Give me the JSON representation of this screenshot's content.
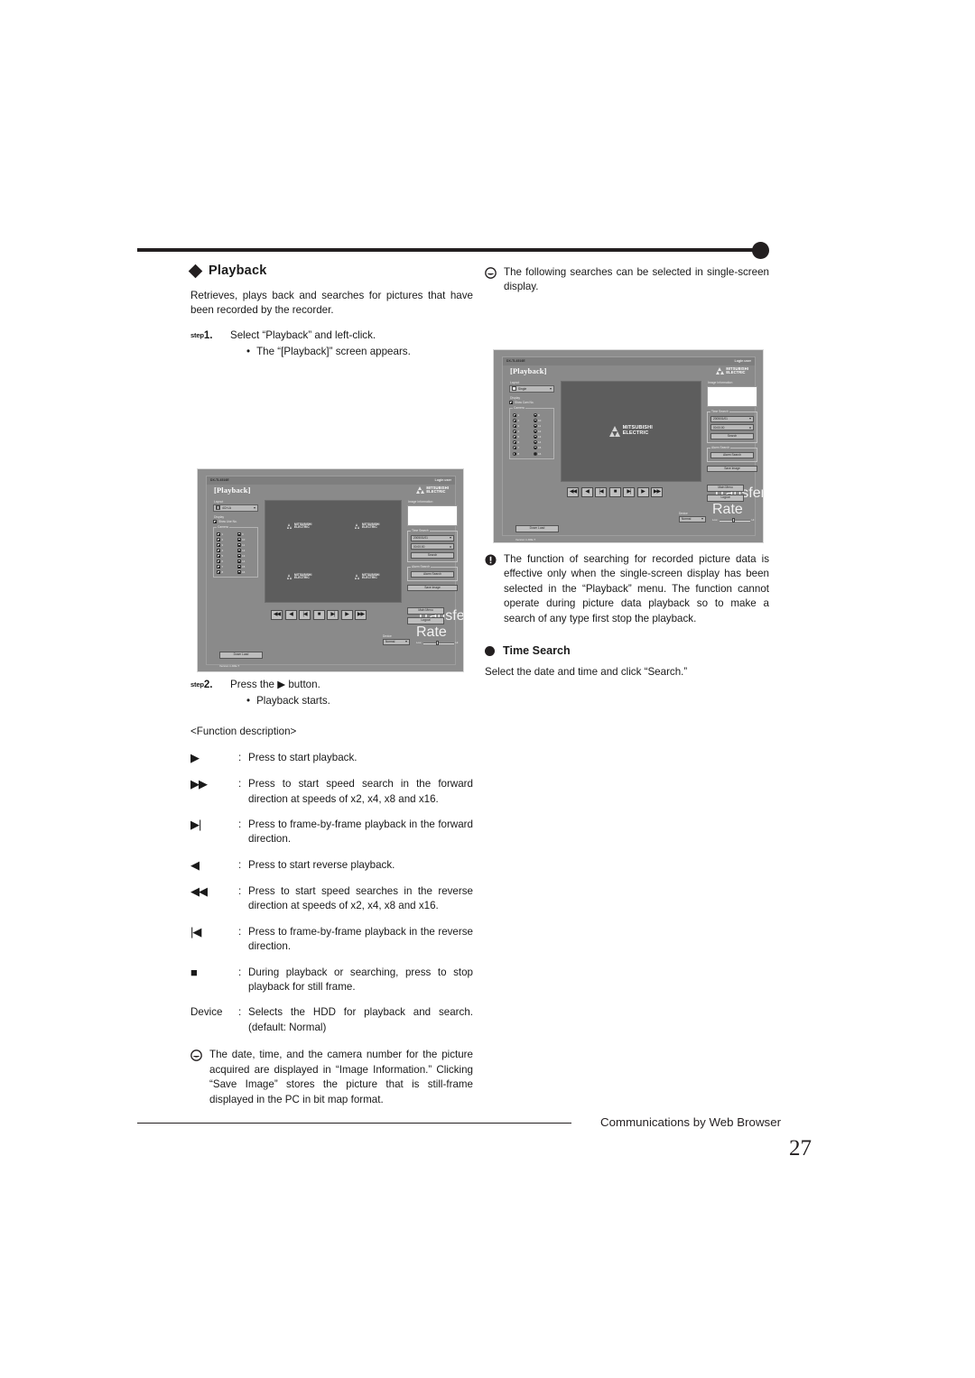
{
  "page": {
    "number": "27",
    "footer_text": "Communications by Web Browser"
  },
  "left_column": {
    "heading": "Playback",
    "intro": "Retrieves, plays back and searches for pictures that have been recorded by the recorder.",
    "step1": {
      "label_sup": "step",
      "label_num": "1.",
      "text": "Select “Playback” and left-click.",
      "bullet_dot": "•",
      "bullet": "The “[Playback]” screen appears."
    },
    "step2": {
      "label_sup": "step",
      "label_num": "2.",
      "text": "Press the ▶ button.",
      "bullet_dot": "•",
      "bullet": "Playback starts."
    },
    "function_description_heading": "<Function description>",
    "functions": [
      {
        "key": "▶",
        "colon": ":",
        "text": "Press to start playback."
      },
      {
        "key": "▶▶",
        "colon": ":",
        "text": "Press to start speed search in the forward direction at speeds of x2, x4, x8 and x16."
      },
      {
        "key": "▶|",
        "colon": ":",
        "text": "Press to frame-by-frame playback in the forward direction."
      },
      {
        "key": "◀",
        "colon": ":",
        "text": "Press to start reverse playback."
      },
      {
        "key": "◀◀",
        "colon": ":",
        "text": "Press to start speed searches in the reverse direction at speeds of x2, x4, x8 and x16."
      },
      {
        "key": "|◀",
        "colon": ":",
        "text": "Press to frame-by-frame playback in the reverse direction."
      },
      {
        "key": "■",
        "colon": ":",
        "text": "During playback or searching, press to stop playback for still frame."
      },
      {
        "key": "Device",
        "colon": ":",
        "text": "Selects the HDD for playback and search. (default: Normal)"
      }
    ],
    "note": "The date, time, and the camera number for the picture acquired are displayed in “Image Information.” Clicking “Save Image” stores the picture that is still-frame displayed in the PC in bit map format."
  },
  "right_column": {
    "note_top": "The following searches can be selected in single-screen display.",
    "warning": "The function of searching for recorded picture data is effective only when the single-screen display has been selected in the “Playback” menu. The function cannot operate during picture data playback so to make a search of any type first stop the playback.",
    "time_search_heading": "Time Search",
    "time_search_text": "Select the date and time and click “Search.”"
  },
  "screenshot_quad": {
    "model": "DX-TL4516E",
    "login_user": "Login user",
    "title": "[Playback]",
    "brand_line1": "MITSUBISHI",
    "brand_line2": "ELECTRIC",
    "sidebar": {
      "layout_caption": "Layout",
      "layout_value": "4CH-A",
      "display_caption": "Display",
      "display_check_label": "Show Live No.",
      "camera_caption": "Camera",
      "cameras": [
        {
          "label": "1",
          "checked": true
        },
        {
          "label": "9",
          "checked": true
        },
        {
          "label": "2",
          "checked": true
        },
        {
          "label": "10",
          "checked": true
        },
        {
          "label": "3",
          "checked": true
        },
        {
          "label": "11",
          "checked": true
        },
        {
          "label": "4",
          "checked": true
        },
        {
          "label": "12",
          "checked": true
        },
        {
          "label": "5",
          "checked": true
        },
        {
          "label": "13",
          "checked": true
        },
        {
          "label": "6",
          "checked": true
        },
        {
          "label": "14",
          "checked": true
        },
        {
          "label": "7",
          "checked": true
        },
        {
          "label": "15",
          "checked": true
        },
        {
          "label": "8",
          "checked": true
        },
        {
          "label": "16",
          "checked": true
        }
      ],
      "bottom_button": "Down Load",
      "version": "Version 1.40E-T"
    },
    "right_panel": {
      "image_info_caption": "Image Information",
      "time_search_caption": "Time Search",
      "date_value": "2005/01/01",
      "time_value": "00:00:00",
      "search_button": "Search",
      "alarm_search_caption": "Alarm Search",
      "alarm_search_button": "Alarm Search",
      "save_image_button": "Save Image",
      "main_menu_button": "Main Menu",
      "logout_button": "Logout"
    },
    "transport": {
      "buttons": [
        "◀◀",
        "◀",
        "|◀",
        "■",
        "▶|",
        "▶",
        "▶▶"
      ],
      "device_caption": "Device",
      "device_value": "Normal",
      "rate_caption": "Transfer Rate",
      "rate_low": "Low",
      "rate_high": "Hi"
    }
  },
  "screenshot_single": {
    "model": "DX-TL4516E",
    "login_user": "Login user",
    "title": "[Playback]",
    "brand_line1": "MITSUBISHI",
    "brand_line2": "ELECTRIC",
    "sidebar": {
      "layout_caption": "Layout",
      "layout_value": "Single",
      "display_caption": "Display",
      "display_check_label": "Show Cam No.",
      "camera_caption": "Camera",
      "cameras": [
        {
          "label": "1",
          "checked": true
        },
        {
          "label": "9",
          "checked": true
        },
        {
          "label": "2",
          "checked": true
        },
        {
          "label": "10",
          "checked": true
        },
        {
          "label": "3",
          "checked": true
        },
        {
          "label": "11",
          "checked": true
        },
        {
          "label": "4",
          "checked": true
        },
        {
          "label": "12",
          "checked": true
        },
        {
          "label": "5",
          "checked": true
        },
        {
          "label": "13",
          "checked": true
        },
        {
          "label": "6",
          "checked": true
        },
        {
          "label": "14",
          "checked": true
        },
        {
          "label": "7",
          "checked": true
        },
        {
          "label": "15",
          "checked": true
        },
        {
          "label": "8",
          "checked": true
        },
        {
          "label": "16",
          "checked": true
        }
      ],
      "bottom_button": "Down Load",
      "version": "Version 1.40E-T"
    },
    "right_panel": {
      "image_info_caption": "Image Information",
      "time_search_caption": "Time Search",
      "date_value": "2005/01/01",
      "time_value": "00:00:00",
      "search_button": "Search",
      "alarm_search_caption": "Alarm Search",
      "alarm_search_button": "Alarm Search",
      "save_image_button": "Save Image",
      "main_menu_button": "Main Menu",
      "logout_button": "Logout"
    },
    "transport": {
      "buttons": [
        "◀◀",
        "◀",
        "|◀",
        "■",
        "▶|",
        "▶",
        "▶▶"
      ],
      "device_caption": "Device",
      "device_value": "Normal",
      "rate_caption": "Transfer Rate",
      "rate_low": "Low",
      "rate_high": "Hi"
    }
  }
}
